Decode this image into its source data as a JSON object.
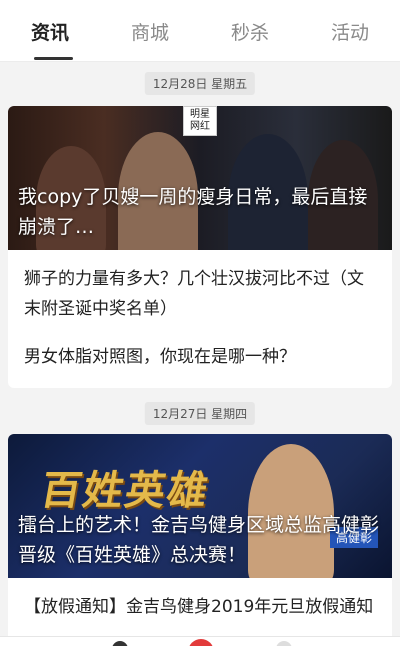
{
  "tabs": [
    {
      "label": "资讯",
      "active": true
    },
    {
      "label": "商城",
      "active": false
    },
    {
      "label": "秒杀",
      "active": false
    },
    {
      "label": "活动",
      "active": false
    }
  ],
  "sections": [
    {
      "date": "12月28日 星期五",
      "hero_caption": "我copy了贝嫂一周的瘦身日常，最后直接崩溃了…",
      "hero_badge": "明星\n网红",
      "items": [
        "狮子的力量有多大？几个壮汉拔河比不过（文末附圣诞中奖名单）",
        "男女体脂对照图，你现在是哪一种？"
      ]
    },
    {
      "date": "12月27日 星期四",
      "hero_title": "百姓英雄",
      "hero_label": "高健彰",
      "hero_caption": "擂台上的艺术！金吉鸟健身区域总监高健彰晋级《百姓英雄》总决赛！",
      "items": [
        "【放假通知】金吉鸟健身2019年元旦放假通知"
      ]
    }
  ],
  "colors": {
    "accent": "#e23b3b",
    "tab_active": "#222222",
    "tab_inactive": "#8a8a8a"
  }
}
